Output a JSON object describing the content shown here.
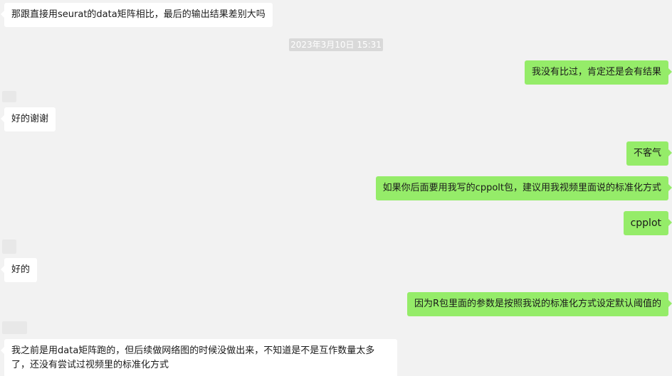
{
  "timestamp": "2023年3月10日 15:31",
  "messages": [
    {
      "side": "in",
      "text": "那跟直接用seurat的data矩阵相比，最后的输出结果差别大吗"
    },
    {
      "side": "out",
      "text": "我没有比过，肯定还是会有结果"
    },
    {
      "side": "in",
      "text": "好的谢谢"
    },
    {
      "side": "out",
      "text": "不客气"
    },
    {
      "side": "out",
      "text": "如果你后面要用我写的cppolt包，建议用我视频里面说的标准化方式"
    },
    {
      "side": "out",
      "text": "cpplot"
    },
    {
      "side": "in",
      "text": "好的"
    },
    {
      "side": "out",
      "text": "因为R包里面的参数是按照我说的标准化方式设定默认阈值的"
    },
    {
      "side": "in",
      "text": "我之前是用data矩阵跑的，但后续做网络图的时候没做出来，不知道是不是互作数量太多了，还没有尝试过视频里的标准化方式"
    }
  ]
}
